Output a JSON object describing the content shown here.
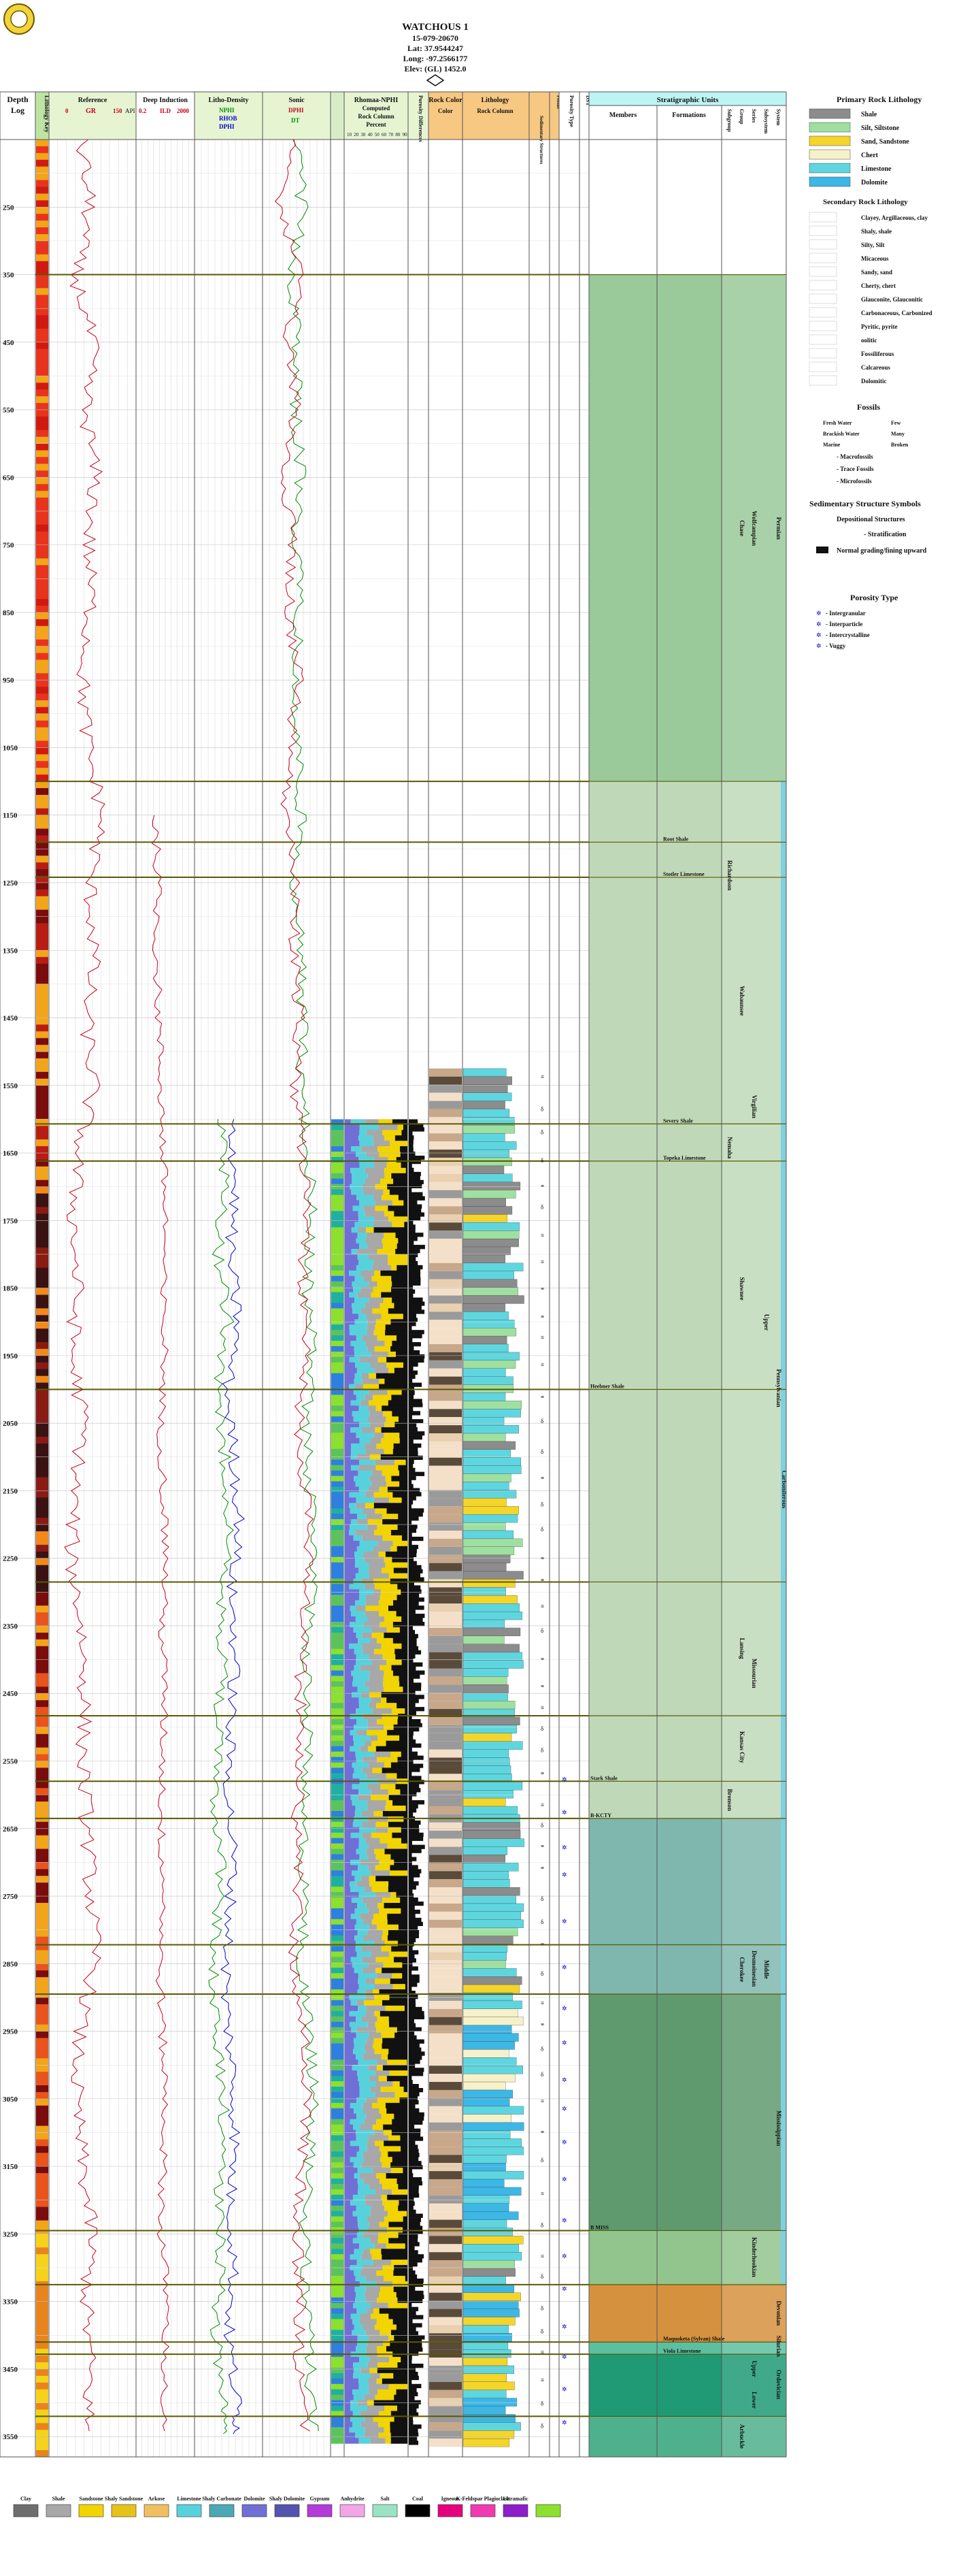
{
  "header": {
    "well_name": "WATCHOUS 1",
    "api": "15-079-20670",
    "lat": "Lat: 37.9544247",
    "long": "Long: -97.2566177",
    "elev": "Elev: (GL) 1452.0"
  },
  "track_headers": {
    "depth_title": "Depth",
    "depth_sub": "Log",
    "lithology_key": "Lithology Key",
    "reference_title": "Reference",
    "reference_curve": "GR",
    "reference_min": "0",
    "reference_max": "150",
    "reference_unit": "API",
    "deep_title": "Deep Induction",
    "deep_curve": "ILD",
    "deep_min": "0.2",
    "deep_max": "2000",
    "litho_title": "Litho-Density",
    "litho_curves": [
      "NPHI",
      "RHOB",
      "DPHI"
    ],
    "sonic_title": "Sonic",
    "sonic_curves": [
      "DPHI",
      "DT"
    ],
    "rhomaa_title": "Rhomaa-NPHI",
    "rhomaa_sub1": "Computed",
    "rhomaa_sub2": "Rock Column",
    "rhomaa_sub3": "Percent",
    "rhomaa_ticks": [
      "10",
      "20",
      "30",
      "40",
      "50",
      "60",
      "70",
      "80",
      "90"
    ],
    "porosity_title": "Porosity Differences",
    "rock_color_title": "Rock Color",
    "rock_color_sub": "Color",
    "lithology_title": "Lithology",
    "lithology_sub": "Rock Column",
    "sed_struct_title": "Sedimentary Structures",
    "fossils_title": "Fossils",
    "porosity_type_title": "Porosity Type",
    "dst_title": "DST",
    "strat_title": "Stratigraphic Units",
    "members_title": "Members",
    "formations_title": "Formations",
    "subgroup_title": "Subgroup",
    "group_title": "Group",
    "series_title": "Series",
    "subsystem_title": "Subsystem",
    "system_title": "System"
  },
  "depth_ticks": [
    "250",
    "350",
    "450",
    "550",
    "650",
    "750",
    "850",
    "950",
    "1050",
    "1150",
    "1250",
    "1350",
    "1450",
    "1550",
    "1650",
    "1750",
    "1850",
    "1950",
    "2050",
    "2150",
    "2250",
    "2350",
    "2450",
    "2550",
    "2650",
    "2750",
    "2850",
    "2950",
    "3050",
    "3150",
    "3250",
    "3350",
    "3450",
    "3550"
  ],
  "depth_range": [
    150,
    3580
  ],
  "tops": [
    {
      "depth": 350,
      "member": ""
    },
    {
      "depth": 1100,
      "member": ""
    },
    {
      "depth": 1190,
      "member": "Root Shale"
    },
    {
      "depth": 1242,
      "member": "Stotler Limestone"
    },
    {
      "depth": 1607,
      "member": "Severy Shale"
    },
    {
      "depth": 1662,
      "member": "Topeka Limestone"
    },
    {
      "depth": 2000,
      "member": "Heebner Shale"
    },
    {
      "depth": 2285,
      "member": ""
    },
    {
      "depth": 2483,
      "member": ""
    },
    {
      "depth": 2580,
      "member": "Stark Shale"
    },
    {
      "depth": 2635,
      "member": "B-KCTY"
    },
    {
      "depth": 2822,
      "member": ""
    },
    {
      "depth": 2895,
      "member": ""
    },
    {
      "depth": 3245,
      "member": "B MISS"
    },
    {
      "depth": 3325,
      "member": ""
    },
    {
      "depth": 3410,
      "member": "Maquoketa (Sylvan) Shale"
    },
    {
      "depth": 3428,
      "member": "Viola Limestone"
    },
    {
      "depth": 3520,
      "member": ""
    }
  ],
  "strat_units": [
    {
      "label": "Chase",
      "col": "group",
      "from": 350,
      "to": 1100
    },
    {
      "label": "Wolfcampian",
      "col": "series",
      "from": 350,
      "to": 1100
    },
    {
      "label": "Permian",
      "col": "system",
      "from": 350,
      "to": 1100
    },
    {
      "label": "Richardson",
      "col": "subgroup",
      "from": 1100,
      "to": 1380
    },
    {
      "label": "Wabaunsee",
      "col": "group",
      "from": 1240,
      "to": 1607
    },
    {
      "label": "Virgilian",
      "col": "series",
      "from": 1500,
      "to": 1670
    },
    {
      "label": "Nemaha",
      "col": "subgroup",
      "from": 1580,
      "to": 1700
    },
    {
      "label": "Shawnee",
      "col": "group",
      "from": 1700,
      "to": 2000
    },
    {
      "label": "Upper",
      "col": "subsystem",
      "from": 1800,
      "to": 2000
    },
    {
      "label": "Pennsylvanian",
      "col": "system",
      "from": 1700,
      "to": 2300
    },
    {
      "label": "Carboniferous",
      "col": "system2",
      "from": 2000,
      "to": 2300
    },
    {
      "label": "Lansing",
      "col": "group",
      "from": 2285,
      "to": 2483
    },
    {
      "label": "Missourian",
      "col": "series",
      "from": 2360,
      "to": 2483
    },
    {
      "label": "Kansas City",
      "col": "group",
      "from": 2483,
      "to": 2580
    },
    {
      "label": "Bronson",
      "col": "subgroup",
      "from": 2580,
      "to": 2635
    },
    {
      "label": "Cherokee",
      "col": "group",
      "from": 2822,
      "to": 2895
    },
    {
      "label": "Middle",
      "col": "subsystem",
      "from": 2822,
      "to": 2895
    },
    {
      "label": "Desmoinesian",
      "col": "series",
      "from": 2822,
      "to": 2895
    },
    {
      "label": "Mississippian",
      "col": "system",
      "from": 2950,
      "to": 3245
    },
    {
      "label": "Kinderhookian",
      "col": "series",
      "from": 3245,
      "to": 3325
    },
    {
      "label": "Devonian",
      "col": "system",
      "from": 3325,
      "to": 3410
    },
    {
      "label": "Silurian",
      "col": "system",
      "from": 3410,
      "to": 3428
    },
    {
      "label": "Ordovician",
      "col": "system",
      "from": 3428,
      "to": 3520
    },
    {
      "label": "Upper",
      "col": "series",
      "from": 3428,
      "to": 3470
    },
    {
      "label": "Lower",
      "col": "series",
      "from": 3470,
      "to": 3520
    },
    {
      "label": "Arbuckle",
      "col": "group",
      "from": 3520,
      "to": 3580
    }
  ],
  "legend": {
    "primary_title": "Primary Rock Lithology",
    "primary": [
      {
        "label": "Shale",
        "color": "#8c8c8c"
      },
      {
        "label": "Silt, Siltstone",
        "color": "#9fe0a0"
      },
      {
        "label": "Sand, Sandstone",
        "color": "#f4d52a"
      },
      {
        "label": "Chert",
        "color": "#f6f1c8"
      },
      {
        "label": "Limestone",
        "color": "#5fd6df"
      },
      {
        "label": "Dolomite",
        "color": "#3cb7e6"
      }
    ],
    "secondary_title": "Secondary Rock Lithology",
    "secondary": [
      "Clayey, Argillaceous, clay",
      "Shaly, shale",
      "Silty, Silt",
      "Micaceous",
      "Sandy, sand",
      "Cherty, chert",
      "Glauconite, Glauconitic",
      "Carbonaceous, Carbonized",
      "Pyritic, pyrite",
      "oolitic",
      "Fossiliferous",
      "Calcareous",
      "Dolomitic"
    ],
    "fossils_title": "Fossils",
    "fossils": [
      "Fresh Water",
      "Brackish Water",
      "Marine",
      "Few",
      "Many",
      "Broken",
      "Macrofossils",
      "Trace Fossils",
      "Microfossils"
    ],
    "sed_title": "Sedimentary Structure Symbols",
    "depo_title": "Depositional Structures",
    "stratification": "Stratification",
    "grading": "Normal grading/fining upward",
    "porosity_title": "Porosity Type",
    "porosity": [
      "Intergranular",
      "Interparticle",
      "Intercrystalline",
      "Vuggy"
    ]
  },
  "bottom_legend": [
    {
      "label": "Clay",
      "color": "#6e6e6e"
    },
    {
      "label": "Shale",
      "color": "#a8a8a8"
    },
    {
      "label": "Sandstone",
      "color": "#f2d400"
    },
    {
      "label": "Shaly Sandstone",
      "color": "#e7c218"
    },
    {
      "label": "Arkose",
      "color": "#f0c060"
    },
    {
      "label": "Limestone",
      "color": "#57d2dd"
    },
    {
      "label": "Shaly Carbonate",
      "color": "#4aa9b4"
    },
    {
      "label": "Dolomite",
      "color": "#6f6fd6"
    },
    {
      "label": "Shaly Dolomite",
      "color": "#5353b0"
    },
    {
      "label": "Gypsum",
      "color": "#b33bd9"
    },
    {
      "label": "Anhydrite",
      "color": "#f2a6e6"
    },
    {
      "label": "Salt",
      "color": "#9be3c5"
    },
    {
      "label": "Coal",
      "color": "#000000"
    },
    {
      "label": "Igneous",
      "color": "#e6007e"
    },
    {
      "label": "K-Feldspar Plagioclase",
      "color": "#f03ab0"
    },
    {
      "label": "Ultramafic",
      "color": "#8c1ecc"
    },
    {
      "label": "",
      "color": "#8ce02e"
    }
  ],
  "chart_data": {
    "type": "line",
    "title": "WATCHOUS 1",
    "xlabel": "",
    "ylabel": "Depth",
    "ylim": [
      150,
      3580
    ],
    "reversed_y": true,
    "grid": true,
    "series": [
      {
        "name": "GR",
        "color": "#c8001a",
        "x_range": [
          0,
          150
        ],
        "values": [
          [
            150,
            55
          ],
          [
            250,
            70
          ],
          [
            350,
            45
          ],
          [
            450,
            75
          ],
          [
            550,
            62
          ],
          [
            650,
            80
          ],
          [
            750,
            68
          ],
          [
            850,
            72
          ],
          [
            950,
            58
          ],
          [
            1050,
            66
          ],
          [
            1150,
            92
          ],
          [
            1250,
            70
          ],
          [
            1350,
            78
          ],
          [
            1450,
            64
          ],
          [
            1550,
            76
          ],
          [
            1650,
            50
          ],
          [
            1750,
            42
          ],
          [
            1850,
            48
          ],
          [
            1950,
            40
          ],
          [
            2050,
            60
          ],
          [
            2150,
            44
          ],
          [
            2250,
            38
          ],
          [
            2350,
            56
          ],
          [
            2450,
            62
          ],
          [
            2550,
            58
          ],
          [
            2650,
            66
          ],
          [
            2750,
            72
          ],
          [
            2850,
            80
          ],
          [
            2950,
            52
          ],
          [
            3050,
            46
          ],
          [
            3150,
            58
          ],
          [
            3250,
            74
          ],
          [
            3350,
            64
          ],
          [
            3450,
            70
          ],
          [
            3550,
            66
          ]
        ]
      },
      {
        "name": "ILD",
        "color": "#c8001a",
        "x_range": [
          0.2,
          2000
        ],
        "values": [
          [
            1150,
            4
          ],
          [
            1250,
            6
          ],
          [
            1350,
            5
          ],
          [
            1450,
            7
          ],
          [
            1550,
            10
          ],
          [
            1650,
            14
          ],
          [
            1750,
            20
          ],
          [
            1850,
            12
          ],
          [
            1950,
            18
          ],
          [
            2050,
            9
          ],
          [
            2150,
            15
          ],
          [
            2250,
            22
          ],
          [
            2350,
            12
          ],
          [
            2450,
            18
          ],
          [
            2550,
            14
          ],
          [
            2650,
            10
          ],
          [
            2750,
            16
          ],
          [
            2850,
            8
          ],
          [
            2950,
            12
          ],
          [
            3050,
            20
          ],
          [
            3150,
            14
          ],
          [
            3250,
            10
          ],
          [
            3350,
            25
          ],
          [
            3450,
            18
          ],
          [
            3550,
            12
          ]
        ]
      },
      {
        "name": "NPHI",
        "color": "#008c00",
        "x_range": [
          0.3,
          -0.1
        ],
        "values": [
          [
            1600,
            0.14
          ],
          [
            1700,
            0.12
          ],
          [
            1800,
            0.16
          ],
          [
            1900,
            0.1
          ],
          [
            2000,
            0.18
          ],
          [
            2100,
            0.12
          ],
          [
            2200,
            0.09
          ],
          [
            2300,
            0.15
          ],
          [
            2400,
            0.13
          ],
          [
            2500,
            0.16
          ],
          [
            2600,
            0.18
          ],
          [
            2700,
            0.14
          ],
          [
            2800,
            0.17
          ],
          [
            2900,
            0.2
          ],
          [
            3000,
            0.15
          ],
          [
            3100,
            0.12
          ],
          [
            3200,
            0.16
          ],
          [
            3300,
            0.14
          ],
          [
            3400,
            0.18
          ],
          [
            3500,
            0.12
          ],
          [
            3550,
            0.1
          ]
        ]
      },
      {
        "name": "RHOB",
        "color": "#0000c8",
        "x_range": [
          2,
          3
        ],
        "values": [
          [
            1600,
            2.55
          ],
          [
            1700,
            2.6
          ],
          [
            1800,
            2.52
          ],
          [
            1900,
            2.64
          ],
          [
            2000,
            2.48
          ],
          [
            2100,
            2.58
          ],
          [
            2200,
            2.66
          ],
          [
            2300,
            2.54
          ],
          [
            2400,
            2.6
          ],
          [
            2500,
            2.52
          ],
          [
            2600,
            2.5
          ],
          [
            2700,
            2.57
          ],
          [
            2800,
            2.5
          ],
          [
            2900,
            2.45
          ],
          [
            3000,
            2.55
          ],
          [
            3100,
            2.6
          ],
          [
            3200,
            2.53
          ],
          [
            3300,
            2.58
          ],
          [
            3400,
            2.5
          ],
          [
            3500,
            2.62
          ],
          [
            3550,
            2.65
          ]
        ]
      },
      {
        "name": "DT",
        "color": "#008c00",
        "x_range": [
          140,
          40
        ],
        "values": [
          [
            150,
            90
          ],
          [
            250,
            82
          ],
          [
            350,
            96
          ],
          [
            450,
            88
          ],
          [
            550,
            92
          ],
          [
            650,
            84
          ],
          [
            750,
            90
          ],
          [
            850,
            86
          ],
          [
            950,
            94
          ],
          [
            1050,
            88
          ],
          [
            1150,
            84
          ],
          [
            1250,
            92
          ],
          [
            1350,
            86
          ],
          [
            1450,
            80
          ],
          [
            1550,
            84
          ],
          [
            1650,
            72
          ],
          [
            1750,
            68
          ],
          [
            1850,
            74
          ],
          [
            1950,
            66
          ],
          [
            2050,
            78
          ],
          [
            2150,
            70
          ],
          [
            2250,
            64
          ],
          [
            2350,
            72
          ],
          [
            2450,
            76
          ],
          [
            2550,
            74
          ],
          [
            2650,
            80
          ],
          [
            2750,
            78
          ],
          [
            2850,
            84
          ],
          [
            2950,
            70
          ],
          [
            3050,
            66
          ],
          [
            3150,
            72
          ],
          [
            3250,
            78
          ],
          [
            3350,
            74
          ],
          [
            3450,
            70
          ],
          [
            3550,
            66
          ]
        ]
      },
      {
        "name": "DPHI",
        "color": "#c8001a",
        "x_range": [
          0.3,
          -0.1
        ],
        "values": [
          [
            150,
            0.12
          ],
          [
            250,
            0.2
          ],
          [
            350,
            0.08
          ],
          [
            450,
            0.16
          ],
          [
            550,
            0.1
          ],
          [
            650,
            0.18
          ],
          [
            750,
            0.12
          ],
          [
            850,
            0.15
          ],
          [
            950,
            0.09
          ],
          [
            1050,
            0.14
          ],
          [
            1150,
            0.17
          ],
          [
            1250,
            0.1
          ],
          [
            1350,
            0.12
          ],
          [
            1450,
            0.08
          ],
          [
            1550,
            0.11
          ],
          [
            1650,
            0.06
          ],
          [
            1750,
            0.04
          ],
          [
            1850,
            0.07
          ],
          [
            1950,
            0.03
          ],
          [
            2050,
            0.09
          ],
          [
            2150,
            0.05
          ],
          [
            2250,
            0.02
          ],
          [
            2350,
            0.06
          ],
          [
            2450,
            0.08
          ],
          [
            2550,
            0.07
          ],
          [
            2650,
            0.1
          ],
          [
            2750,
            0.09
          ],
          [
            2850,
            0.12
          ],
          [
            2950,
            0.06
          ],
          [
            3050,
            0.04
          ],
          [
            3150,
            0.07
          ],
          [
            3250,
            0.1
          ],
          [
            3350,
            0.08
          ],
          [
            3450,
            0.09
          ],
          [
            3550,
            0.05
          ]
        ]
      }
    ]
  }
}
